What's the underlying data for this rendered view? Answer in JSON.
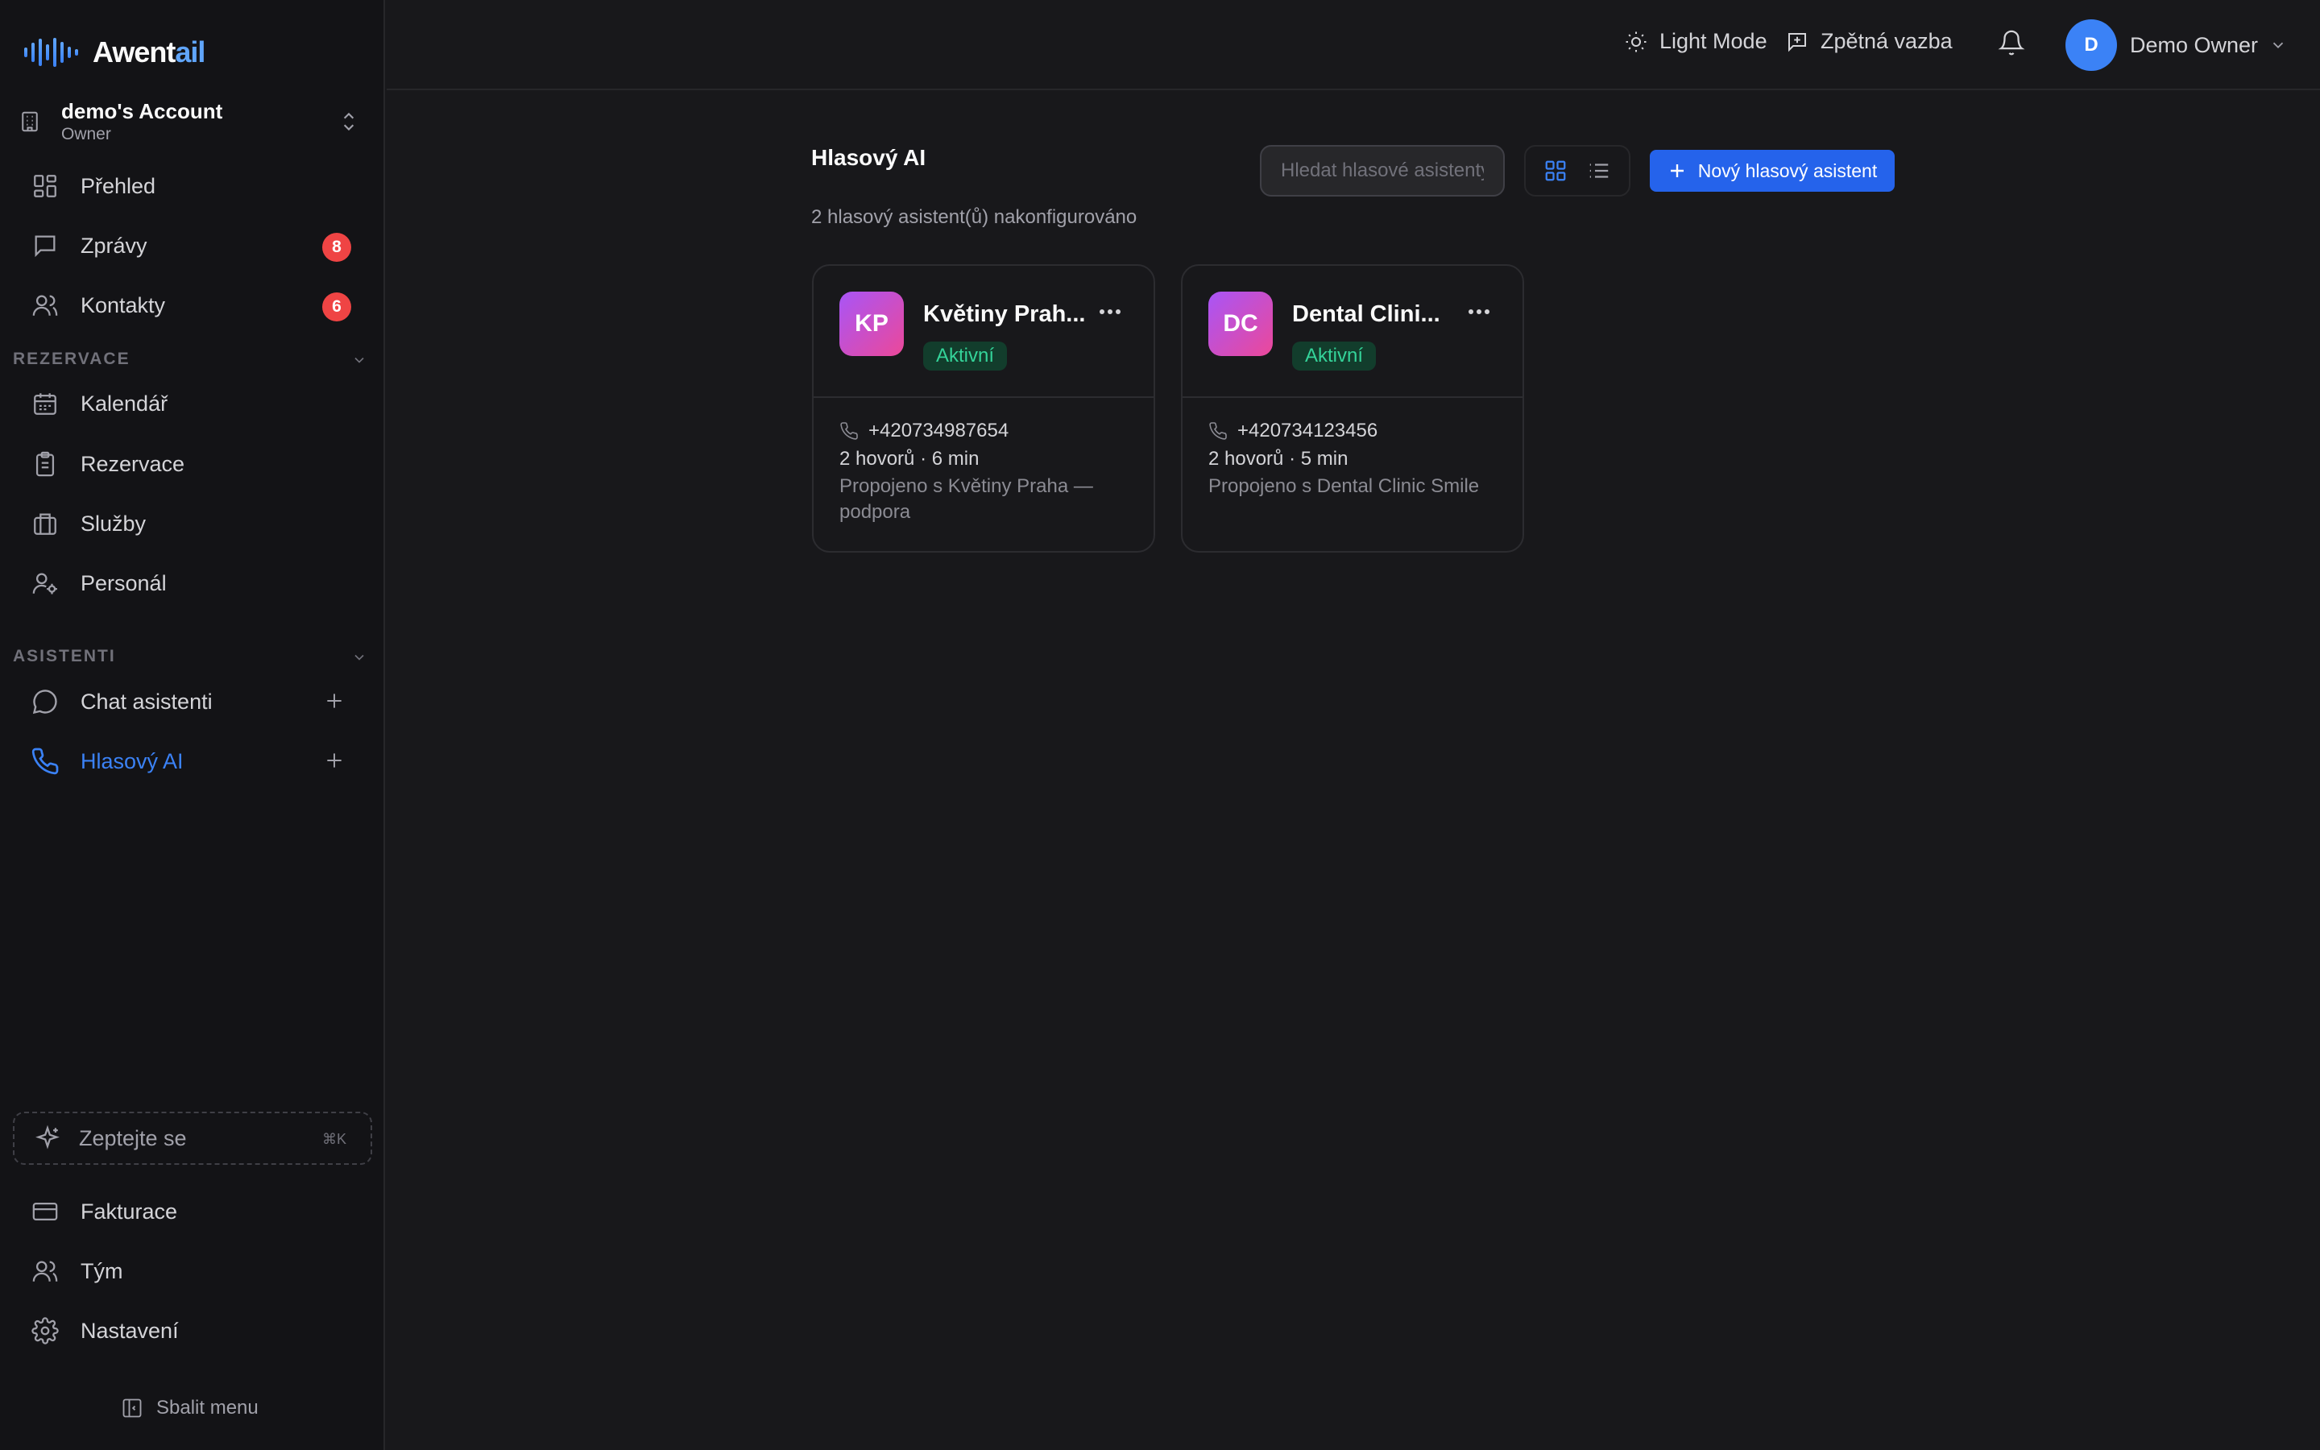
{
  "brand": {
    "name_prefix": "Awent",
    "name_accent": "ail",
    "accent_color": "#60a5fa"
  },
  "account": {
    "name": "demo's Account",
    "role": "Owner"
  },
  "sidebar": {
    "main": [
      {
        "label": "Přehled"
      },
      {
        "label": "Zprávy",
        "badge": "8"
      },
      {
        "label": "Kontakty",
        "badge": "6"
      }
    ],
    "section_bookings": "REZERVACE",
    "bookings": [
      {
        "label": "Kalendář"
      },
      {
        "label": "Rezervace"
      },
      {
        "label": "Služby"
      },
      {
        "label": "Personál"
      }
    ],
    "section_assistants": "ASISTENTI",
    "assistants": [
      {
        "label": "Chat asistenti"
      },
      {
        "label": "Hlasový AI",
        "active": true
      }
    ],
    "ask": {
      "label": "Zeptejte se",
      "shortcut": "⌘K"
    },
    "bottom": [
      {
        "label": "Fakturace"
      },
      {
        "label": "Tým"
      },
      {
        "label": "Nastavení"
      }
    ],
    "collapse_label": "Sbalit menu"
  },
  "topbar": {
    "theme_label": "Light Mode",
    "feedback_label": "Zpětná vazba",
    "user": {
      "initial": "D",
      "name": "Demo Owner"
    }
  },
  "main": {
    "title": "Hlasový AI",
    "subtitle": "2 hlasový asistent(ů) nakonfigurováno",
    "search_placeholder": "Hledat hlasové asistenty",
    "new_button_label": "Nový hlasový asistent",
    "cards": [
      {
        "initials": "KP",
        "name": "Květiny Prah...",
        "status": "Aktivní",
        "phone": "+420734987654",
        "calls": "2 hovorů · 6 min",
        "link": "Propojeno s Květiny Praha — podpora"
      },
      {
        "initials": "DC",
        "name": "Dental Clini...",
        "status": "Aktivní",
        "phone": "+420734123456",
        "calls": "2 hovorů · 5 min",
        "link": "Propojeno s Dental Clinic Smile"
      }
    ]
  },
  "colors": {
    "primary": "#2563eb",
    "active_nav": "#3b82f6",
    "badge": "#ef4444",
    "status_active": "#34d399",
    "background": "#18181b",
    "sidebar": "#131316"
  }
}
